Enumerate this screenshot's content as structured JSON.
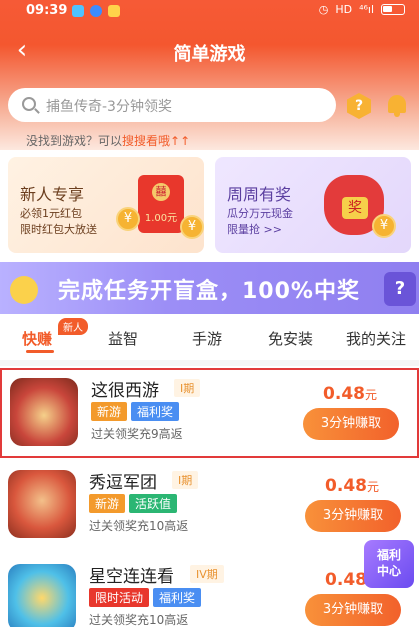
{
  "status_bar": {
    "time": "09:39",
    "signal": "⁴⁶ıl",
    "hd": "HD"
  },
  "header": {
    "back_glyph": "‹",
    "title": "简单游戏"
  },
  "search": {
    "placeholder": "捕鱼传奇-3分钟领奖",
    "help_glyph": "?"
  },
  "hint": {
    "prefix": "没找到游戏？可以",
    "link": "搜搜看哦",
    "arrows": "↑↑"
  },
  "promo_cards": [
    {
      "title": "新人专享",
      "line1": "必领1元红包",
      "line2": "限时红包大放送",
      "amount": "1.00元",
      "seal": "囍"
    },
    {
      "title": "周周有奖",
      "line1": "瓜分万元现金",
      "line2": "限量抢 >>",
      "badge": "奖"
    }
  ],
  "banner": {
    "text": "完成任务开盲盒，100%中奖",
    "box_glyph": "?"
  },
  "tabs": [
    {
      "label": "快赚",
      "active": true
    },
    {
      "label": "益智",
      "active": false
    },
    {
      "label": "手游",
      "active": false
    },
    {
      "label": "免安装",
      "active": false
    },
    {
      "label": "我的关注",
      "active": false
    }
  ],
  "new_tag": "新人",
  "games": [
    {
      "name": "这很西游",
      "period": "I期",
      "tags": [
        "新游",
        "福利奖"
      ],
      "desc": "过关领奖充9高返",
      "reward": "0.48",
      "unit": "元",
      "button": "3分钟赚取"
    },
    {
      "name": "秀逗军团",
      "period": "I期",
      "tags": [
        "新游",
        "活跃值"
      ],
      "desc": "过关领奖充10高返",
      "reward": "0.48",
      "unit": "元",
      "button": "3分钟赚取"
    },
    {
      "name": "星空连连看",
      "period": "IV期",
      "tags": [
        "限时活动",
        "福利奖"
      ],
      "desc": "过关领奖充10高返",
      "reward": "0.48",
      "unit": "元",
      "button": "3分钟赚取"
    }
  ],
  "float_badge": {
    "line1": "福利",
    "line2": "中心"
  },
  "colors": {
    "accent": "#f25c2a",
    "tag_orange": "#f39a2c",
    "tag_blue": "#4a8ef2",
    "tag_green": "#2bb673",
    "tag_red": "#e8372c"
  }
}
